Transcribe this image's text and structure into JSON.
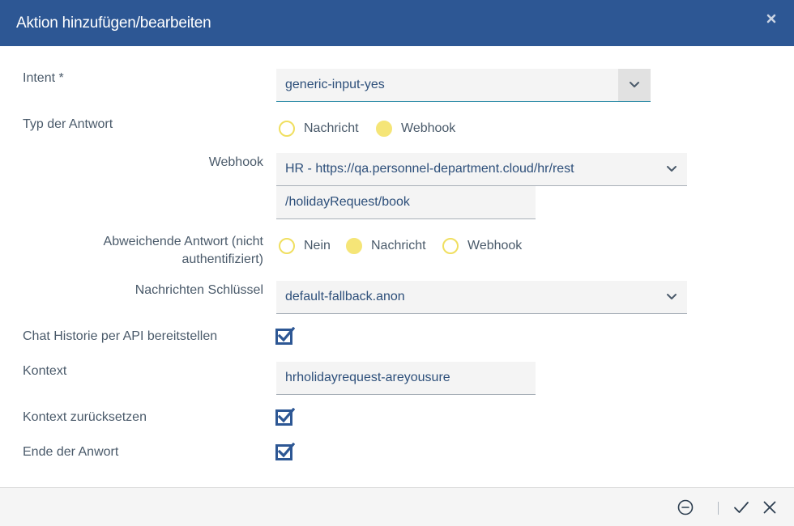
{
  "dialog": {
    "title": "Aktion hinzufügen/bearbeiten"
  },
  "form": {
    "intent": {
      "label": "Intent *",
      "value": "generic-input-yes"
    },
    "response_type": {
      "label": "Typ der Antwort",
      "options": [
        "Nachricht",
        "Webhook"
      ],
      "selected": "Webhook"
    },
    "webhook": {
      "label": "Webhook",
      "value": "HR - https://qa.personnel-department.cloud/hr/rest",
      "path": "/holidayRequest/book"
    },
    "alt_response": {
      "label_line1": "Abweichende Antwort (nicht",
      "label_line2": "authentifiziert)",
      "options": [
        "Nein",
        "Nachricht",
        "Webhook"
      ],
      "selected": "Nachricht"
    },
    "message_key": {
      "label": "Nachrichten Schlüssel",
      "value": "default-fallback.anon"
    },
    "chat_history": {
      "label": "Chat Historie per API bereitstellen",
      "checked": true
    },
    "context": {
      "label": "Kontext",
      "value": "hrholidayrequest-areyousure"
    },
    "reset_context": {
      "label": "Kontext zurücksetzen",
      "checked": true
    },
    "end_of_answer": {
      "label": "Ende der Anwort",
      "checked": true
    }
  },
  "icons": {
    "header_close": "close-icon",
    "footer_remove": "minus-circle-icon",
    "footer_confirm": "check-icon",
    "footer_cancel": "close-icon"
  },
  "colors": {
    "header_bg": "#2d5794",
    "radio_yellow": "#f5e577",
    "checkbox_blue": "#2d5794",
    "field_text": "#2d4f7a",
    "focus_line": "#2a8aa6"
  }
}
